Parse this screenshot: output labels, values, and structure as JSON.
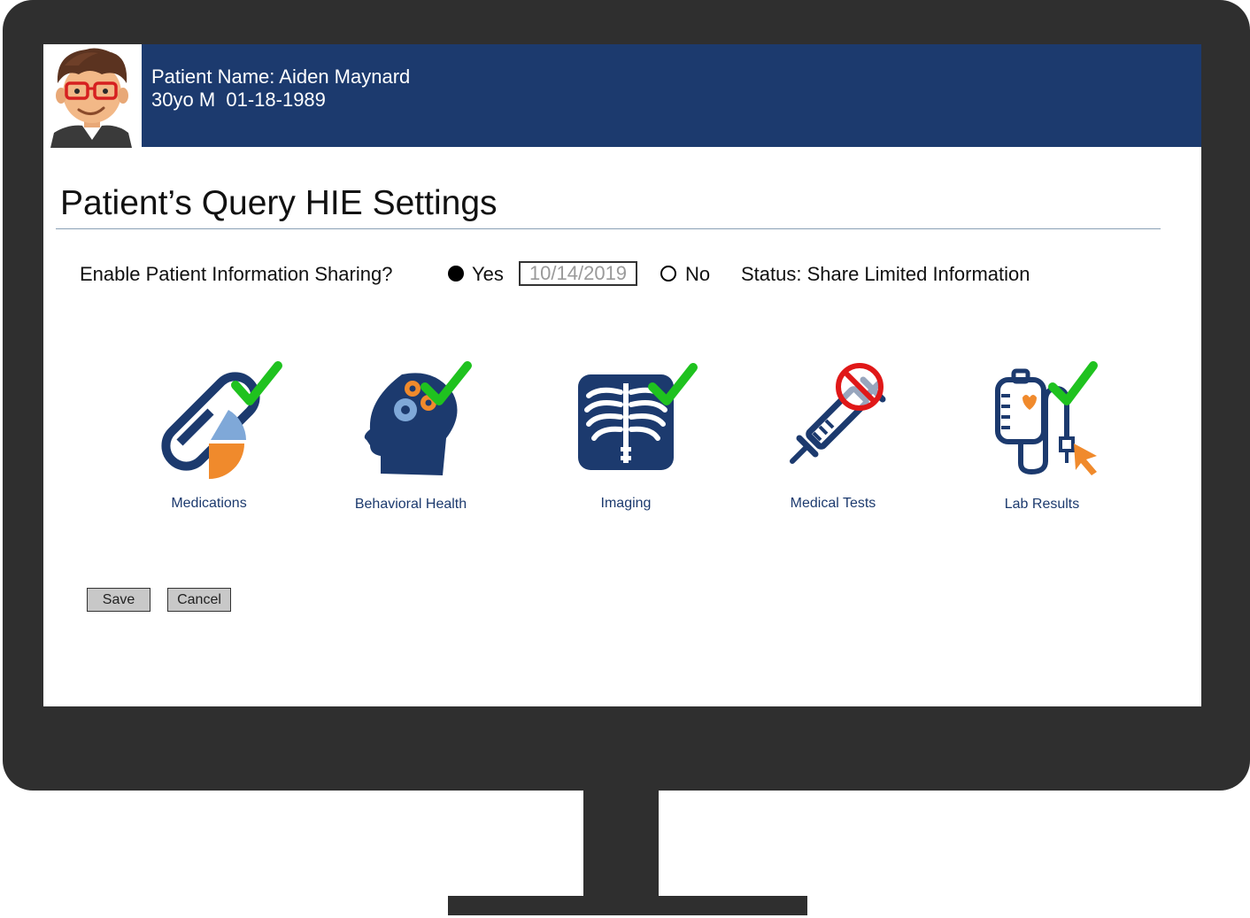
{
  "patient": {
    "name": "Patient Name: Aiden Maynard",
    "info": "30yo M  01-18-1989"
  },
  "page": {
    "title": "Patient’s Query HIE Settings"
  },
  "sharing": {
    "question": "Enable Patient Information Sharing?",
    "yes_label": "Yes",
    "yes_selected": true,
    "date_value": "10/14/2019",
    "no_label": "No",
    "status": "Status: Share Limited Information"
  },
  "categories": [
    {
      "label": "Medications",
      "icon": "pill-icon",
      "state": "allowed"
    },
    {
      "label": "Behavioral Health",
      "icon": "brain-gears-icon",
      "state": "allowed"
    },
    {
      "label": "Imaging",
      "icon": "xray-icon",
      "state": "allowed"
    },
    {
      "label": "Medical Tests",
      "icon": "syringe-icon",
      "state": "blocked"
    },
    {
      "label": "Lab Results",
      "icon": "iv-bag-icon",
      "state": "allowed"
    }
  ],
  "actions": {
    "save_label": "Save",
    "cancel_label": "Cancel"
  },
  "colors": {
    "banner": "#1c3a6e",
    "icon_navy": "#1c3a6e",
    "accent_orange": "#f08a2c",
    "accent_blue": "#7fa8d8",
    "check_green": "#1fc21f",
    "block_red": "#e01818"
  }
}
